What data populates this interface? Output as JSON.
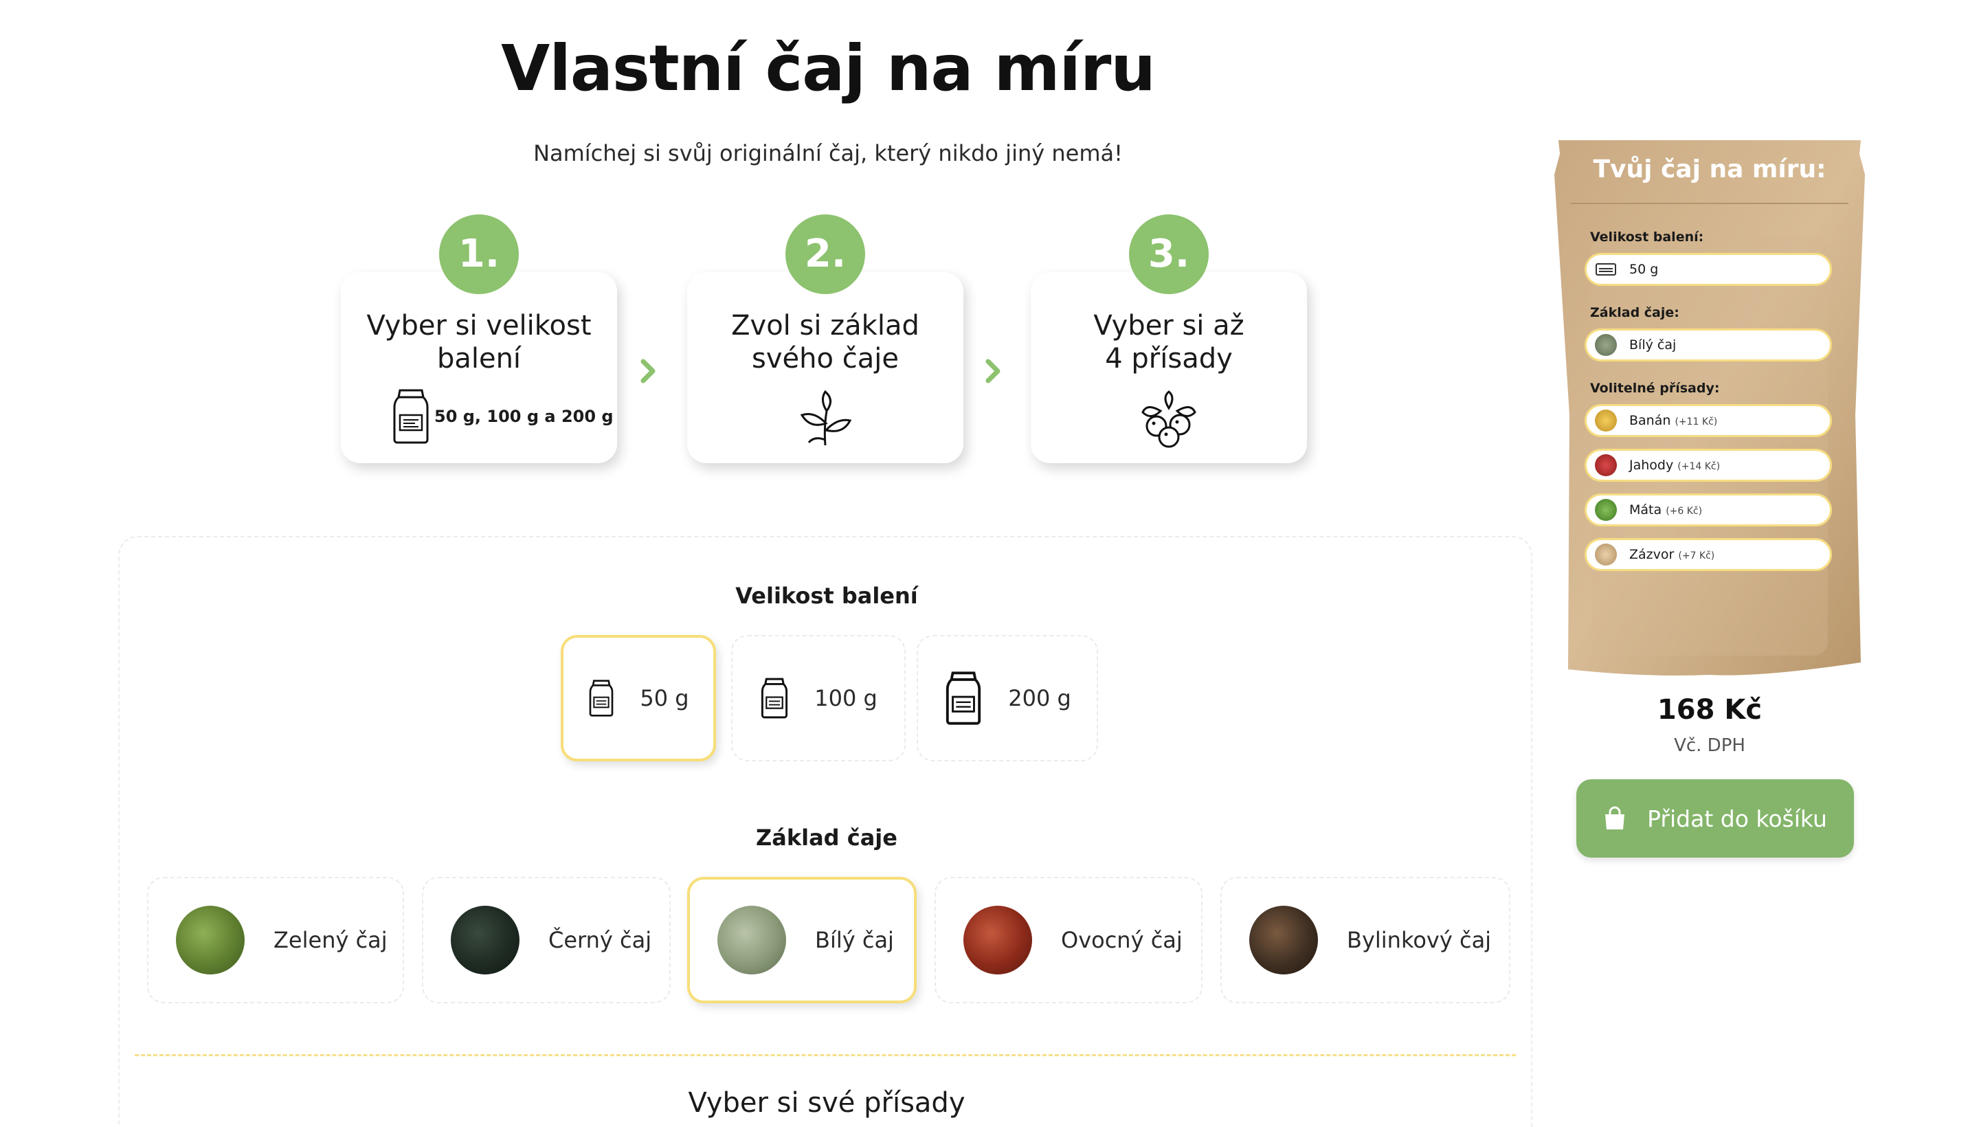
{
  "header": {
    "title": "Vlastní čaj na míru",
    "subtitle": "Namíchej si svůj originální čaj, který nikdo jiný nemá!"
  },
  "steps": [
    {
      "number": "1.",
      "title": "Vyber si velikost\nbalení",
      "caption": "50 g, 100 g a 200 g",
      "icon": "tea-bag-icon"
    },
    {
      "number": "2.",
      "title": "Zvol si základ\nsvého čaje",
      "icon": "tea-leaf-icon"
    },
    {
      "number": "3.",
      "title": "Vyber si až\n4 přísady",
      "icon": "berries-icon"
    }
  ],
  "builder": {
    "size_title": "Velikost balení",
    "sizes": [
      {
        "label": "50 g",
        "selected": true
      },
      {
        "label": "100 g",
        "selected": false
      },
      {
        "label": "200 g",
        "selected": false
      }
    ],
    "base_title": "Základ čaje",
    "bases": [
      {
        "label": "Zelený čaj",
        "color": "#6f8f3e",
        "selected": false
      },
      {
        "label": "Černý čaj",
        "color": "#1f2a22",
        "selected": false
      },
      {
        "label": "Bílý čaj",
        "color": "#8a9a78",
        "selected": true
      },
      {
        "label": "Ovocný čaj",
        "color": "#8c2a1a",
        "selected": false
      },
      {
        "label": "Bylinkový čaj",
        "color": "#3f2f22",
        "selected": false
      }
    ],
    "ingredients_title": "Vyber si své přísady"
  },
  "summary": {
    "title": "Tvůj čaj na míru:",
    "size_label": "Velikost balení:",
    "size_value": "50 g",
    "base_label": "Základ čaje:",
    "base_value": "Bílý čaj",
    "extras_label": "Volitelné přísady:",
    "extras": [
      {
        "name": "Banán",
        "price": "(+11 Kč)",
        "color": "#e1b33c"
      },
      {
        "name": "Jahody",
        "price": "(+14 Kč)",
        "color": "#b02a2a"
      },
      {
        "name": "Máta",
        "price": "(+6 Kč)",
        "color": "#5f9a35"
      },
      {
        "name": "Zázvor",
        "price": "(+7 Kč)",
        "color": "#d7b48a"
      }
    ],
    "price": "168 Kč",
    "vat": "Vč. DPH",
    "cart_button": "Přidat do košíku"
  },
  "colors": {
    "accent_green": "#8dc26e",
    "button_green": "#84b56a",
    "selected_border": "#f7de7a"
  }
}
